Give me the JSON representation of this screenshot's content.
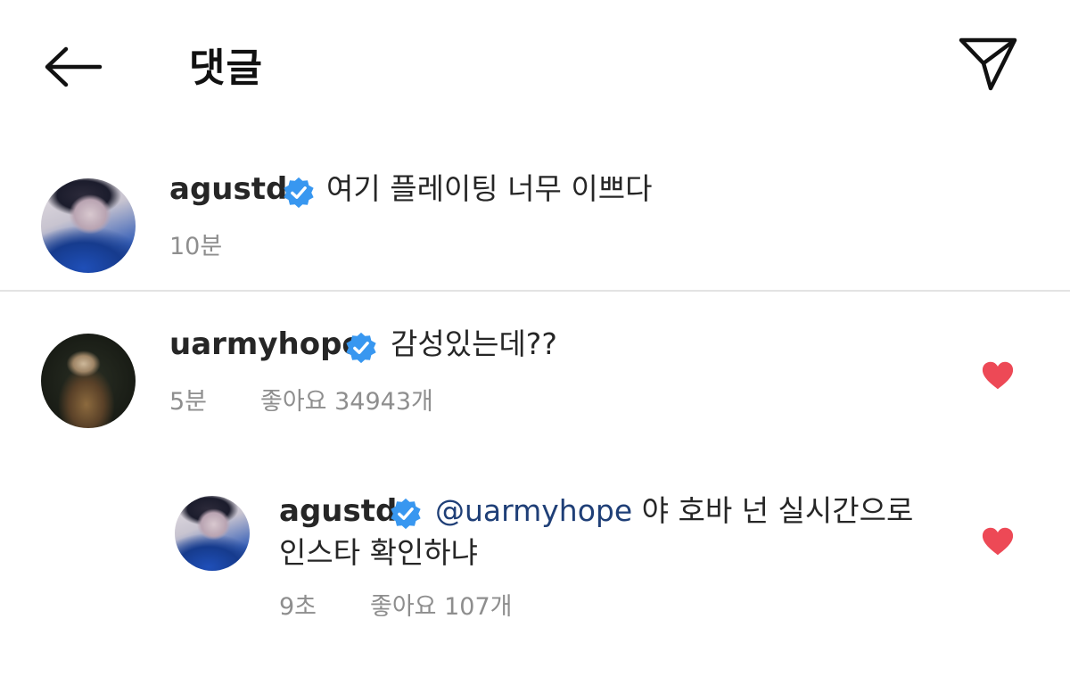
{
  "header": {
    "title": "댓글",
    "back_icon": "arrow-left-icon",
    "share_icon": "paper-plane-icon"
  },
  "caption": {
    "username": "agustd",
    "text": "여기 플레이팅 너무 이쁘다",
    "time": "10분"
  },
  "comments": [
    {
      "username": "uarmyhope",
      "text": "감성있는데??",
      "time": "5분",
      "likes": "좋아요 34943개",
      "liked": true
    }
  ],
  "replies": [
    {
      "username": "agustd",
      "mention": "@uarmyhope",
      "text_line1": " 야 호바 넌 실시간으로",
      "text_line2": "인스타 확인하냐",
      "time": "9초",
      "likes": "좋아요 107개",
      "liked": true
    }
  ],
  "colors": {
    "verified_blue": "#3897f0",
    "heart_red": "#ed4956",
    "meta_gray": "#8e8e8e",
    "mention_blue": "#1f3f77"
  }
}
